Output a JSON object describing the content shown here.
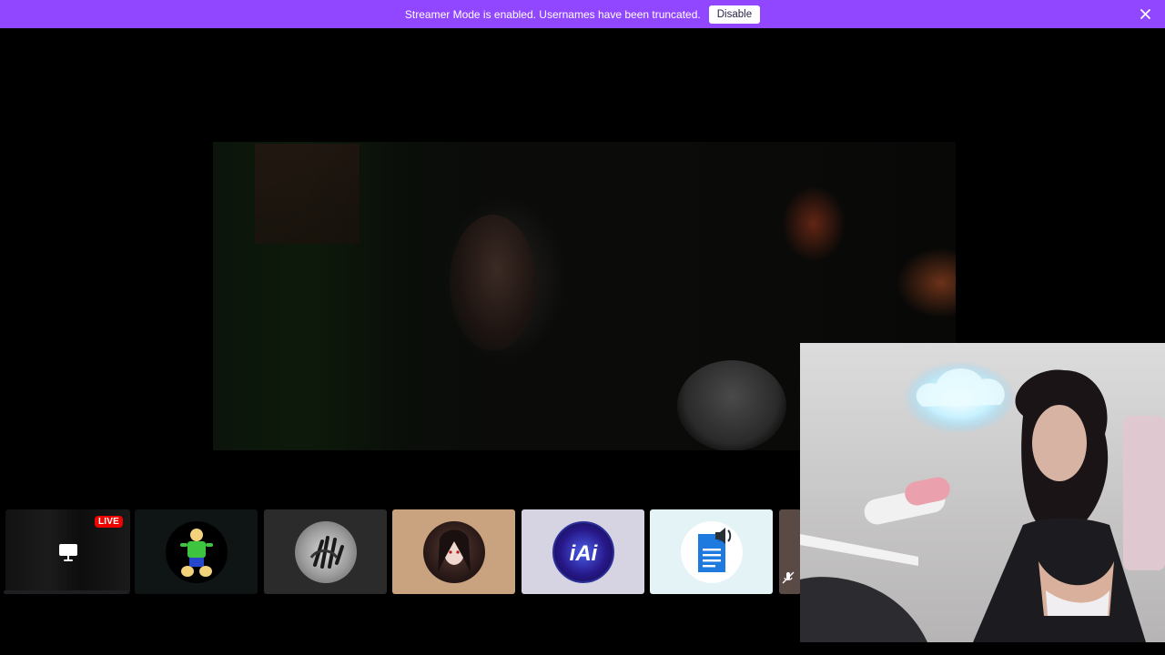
{
  "banner": {
    "message": "Streamer Mode is enabled. Usernames have been truncated.",
    "disable_label": "Disable",
    "close_icon": "close-icon",
    "color": "#9147ff"
  },
  "tiles": [
    {
      "kind": "screen-share",
      "badge": "LIVE",
      "icon": "monitor-icon"
    },
    {
      "kind": "avatar",
      "icon": "character-avatar"
    },
    {
      "kind": "avatar",
      "icon": "handprint-avatar"
    },
    {
      "kind": "avatar",
      "icon": "anime-avatar"
    },
    {
      "kind": "avatar",
      "icon": "iai-logo-avatar"
    },
    {
      "kind": "avatar",
      "icon": "document-speaker-avatar"
    },
    {
      "kind": "partial",
      "icon": "muted-mic-icon"
    }
  ],
  "colors": {
    "live_badge": "#eb0400",
    "tile_dark": "#2b2b2b",
    "tile_tan": "#c9a27f",
    "tile_lilac": "#d6d3e3",
    "tile_lightblue": "#e3f3f6"
  }
}
